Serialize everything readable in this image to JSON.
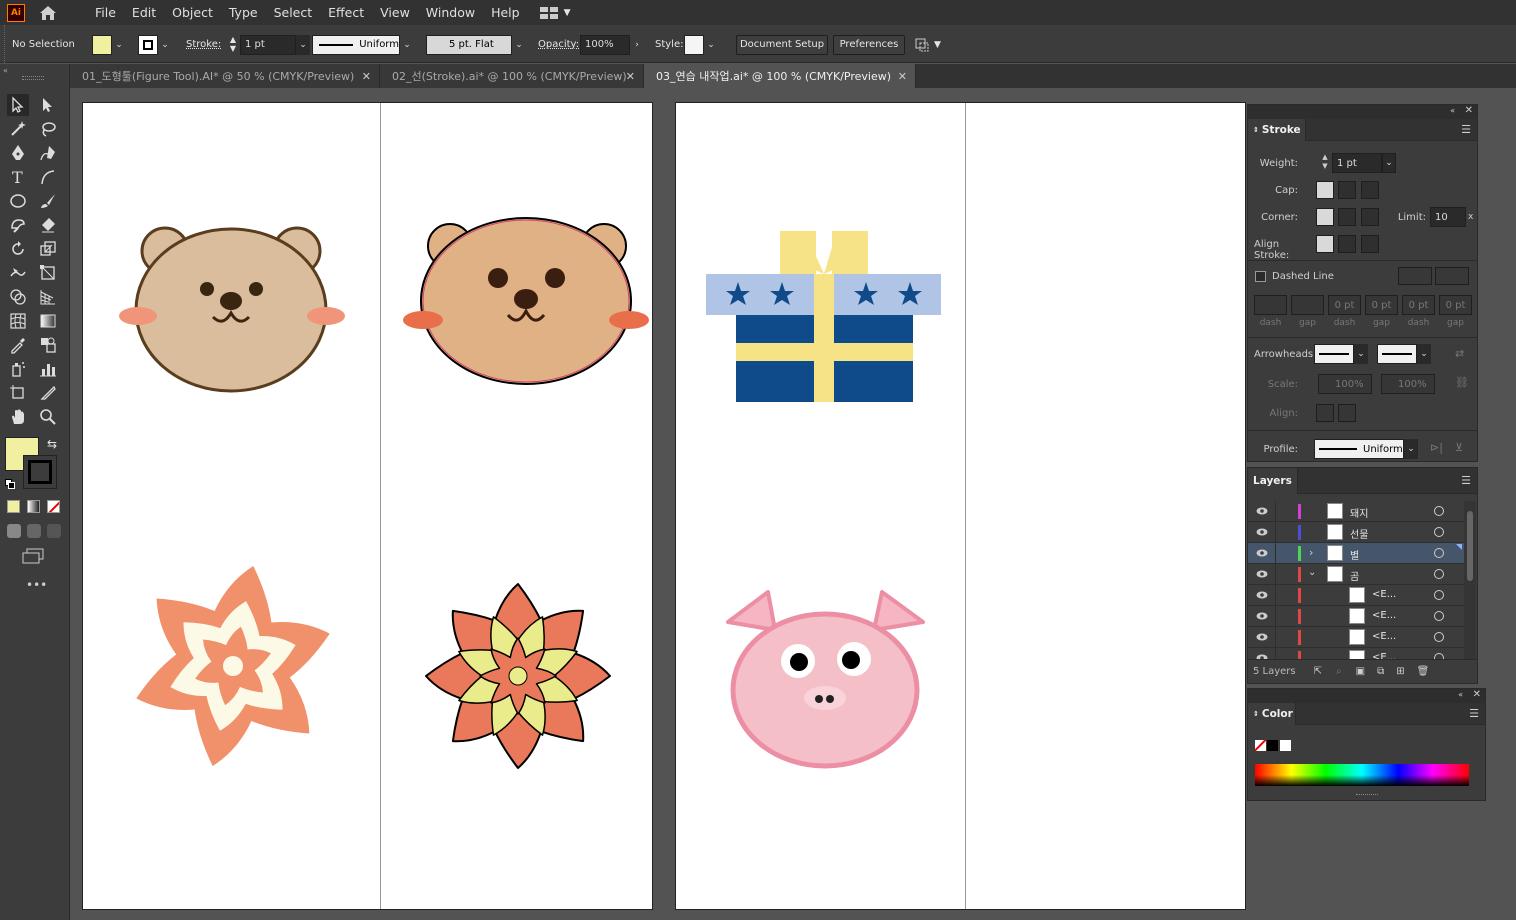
{
  "menubar": {
    "logo": "Ai",
    "items": [
      "File",
      "Edit",
      "Object",
      "Type",
      "Select",
      "Effect",
      "View",
      "Window",
      "Help"
    ]
  },
  "controlbar": {
    "selection_status": "No Selection",
    "fill_color": "#f0f0a0",
    "stroke_label": "Stroke:",
    "stroke_weight": "1 pt",
    "profile": "Uniform",
    "brush": "5 pt. Flat",
    "opacity_label": "Opacity:",
    "opacity_value": "100%",
    "style_label": "Style:",
    "document_setup": "Document Setup",
    "preferences": "Preferences"
  },
  "tabs": [
    {
      "label": "01_도형툴(Figure Tool).AI* @ 50 % (CMYK/Preview)",
      "active": false
    },
    {
      "label": "02_선(Stroke).ai* @ 100 % (CMYK/Preview)",
      "active": false
    },
    {
      "label": "03_연습 내작업.ai* @ 100 % (CMYK/Preview)",
      "active": true
    }
  ],
  "toolbar": {
    "fill_color": "#f0f0a0",
    "stroke_color": "#000000",
    "more": "•••"
  },
  "stroke_panel": {
    "title": "Stroke",
    "weight_label": "Weight:",
    "weight_value": "1 pt",
    "cap_label": "Cap:",
    "corner_label": "Corner:",
    "limit_label": "Limit:",
    "limit_value": "10",
    "limit_unit": "x",
    "align_label": "Align Stroke:",
    "dashed_label": "Dashed Line",
    "dash_fields": [
      "",
      "",
      "0 pt",
      "0 pt",
      "0 pt",
      "0 pt"
    ],
    "dash_labels": [
      "dash",
      "gap",
      "dash",
      "gap",
      "dash",
      "gap"
    ],
    "arrowheads_label": "Arrowheads:",
    "scale_label": "Scale:",
    "scale_values": [
      "100%",
      "100%"
    ],
    "align_arrow_label": "Align:",
    "profile_label": "Profile:",
    "profile_value": "Uniform"
  },
  "layers_panel": {
    "title": "Layers",
    "layers": [
      {
        "name": "돼지",
        "color": "#d63fd6",
        "expanded": null,
        "indent": 0,
        "selected": false
      },
      {
        "name": "선물",
        "color": "#4f4fd6",
        "expanded": null,
        "indent": 0,
        "selected": false
      },
      {
        "name": "별",
        "color": "#4fd64f",
        "expanded": false,
        "indent": 0,
        "selected": true
      },
      {
        "name": "곰",
        "color": "#e04848",
        "expanded": true,
        "indent": 0,
        "selected": false
      },
      {
        "name": "<E...",
        "color": "#e04848",
        "expanded": null,
        "indent": 1,
        "selected": false
      },
      {
        "name": "<E...",
        "color": "#e04848",
        "expanded": null,
        "indent": 1,
        "selected": false
      },
      {
        "name": "<E...",
        "color": "#e04848",
        "expanded": null,
        "indent": 1,
        "selected": false
      },
      {
        "name": "<E...",
        "color": "#e04848",
        "expanded": null,
        "indent": 1,
        "selected": false
      }
    ],
    "count": "5 Layers"
  },
  "color_panel": {
    "title": "Color"
  }
}
